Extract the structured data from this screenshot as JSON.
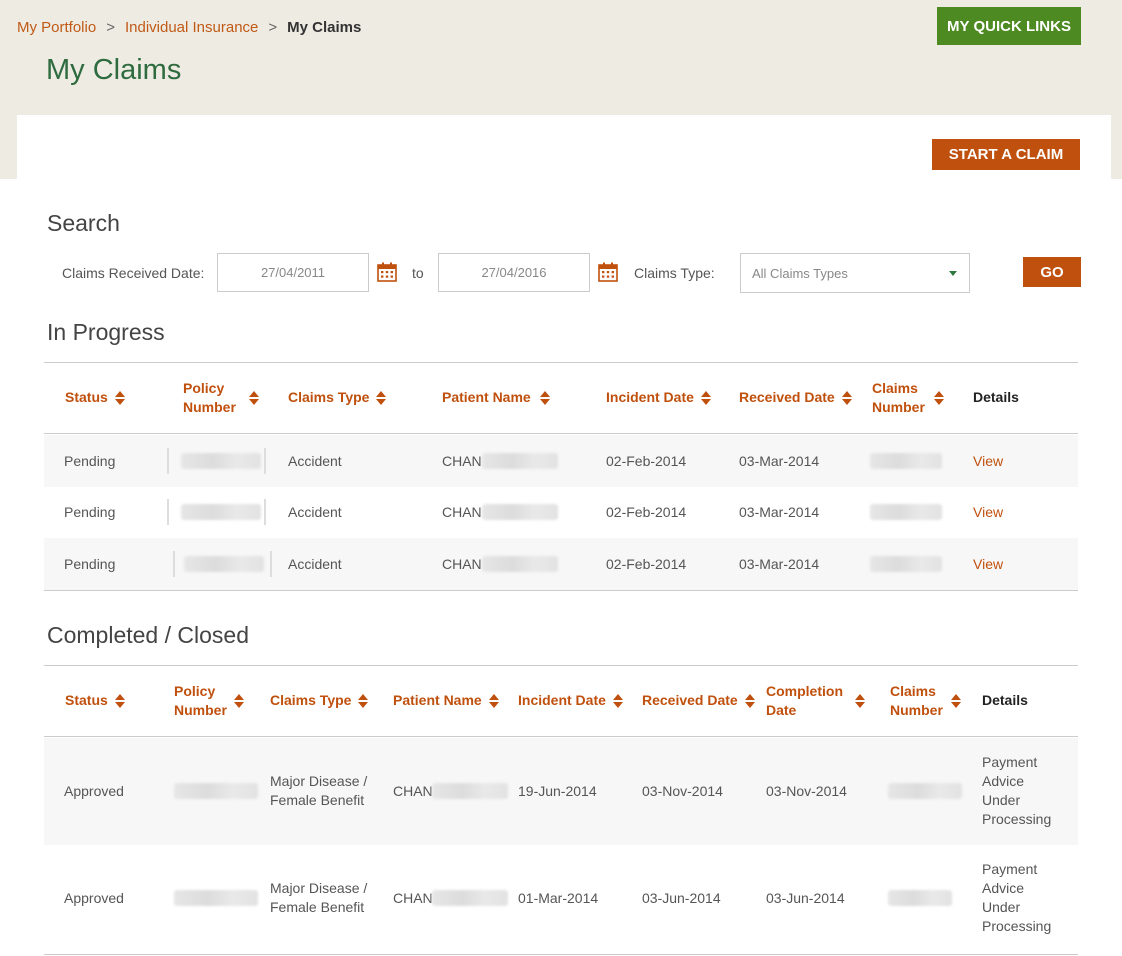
{
  "breadcrumb": {
    "items": [
      "My Portfolio",
      "Individual Insurance"
    ],
    "current": "My Claims",
    "separator": ">"
  },
  "header": {
    "title": "My Claims",
    "quick_links_label": "MY QUICK LINKS",
    "start_claim_label": "START A CLAIM"
  },
  "search": {
    "title": "Search",
    "received_date_label": "Claims Received Date:",
    "from_date": "27/04/2011",
    "to_label": "to",
    "to_date": "27/04/2016",
    "claims_type_label": "Claims Type:",
    "claims_type_value": "All Claims Types",
    "go_label": "GO"
  },
  "in_progress": {
    "title": "In Progress",
    "headers": {
      "status": "Status",
      "policy_1": "Policy",
      "policy_2": "Number",
      "claims_type": "Claims Type",
      "patient_name": "Patient Name",
      "incident_date": "Incident Date",
      "received_date": "Received Date",
      "claims_1": "Claims",
      "claims_2": "Number",
      "details": "Details"
    },
    "rows": [
      {
        "status": "Pending",
        "claims_type": "Accident",
        "patient": "CHAN",
        "incident": "02-Feb-2014",
        "received": "03-Mar-2014",
        "details": "View"
      },
      {
        "status": "Pending",
        "claims_type": "Accident",
        "patient": "CHAN",
        "incident": "02-Feb-2014",
        "received": "03-Mar-2014",
        "details": "View"
      },
      {
        "status": "Pending",
        "claims_type": "Accident",
        "patient": "CHAN",
        "incident": "02-Feb-2014",
        "received": "03-Mar-2014",
        "details": "View"
      }
    ]
  },
  "completed": {
    "title": "Completed / Closed",
    "headers": {
      "status": "Status",
      "policy_1": "Policy",
      "policy_2": "Number",
      "claims_type": "Claims Type",
      "patient_name": "Patient Name",
      "incident_date": "Incident Date",
      "received_date": "Received Date",
      "completion_1": "Completion",
      "completion_2": "Date",
      "claims_1": "Claims",
      "claims_2": "Number",
      "details": "Details"
    },
    "rows": [
      {
        "status": "Approved",
        "type_1": "Major Disease /",
        "type_2": "Female Benefit",
        "patient": "CHAN",
        "incident": "19-Jun-2014",
        "received": "03-Nov-2014",
        "completion": "03-Nov-2014",
        "details_1": "Payment",
        "details_2": "Advice",
        "details_3": "Under",
        "details_4": "Processing"
      },
      {
        "status": "Approved",
        "type_1": "Major Disease /",
        "type_2": "Female Benefit",
        "patient": "CHAN",
        "incident": "01-Mar-2014",
        "received": "03-Jun-2014",
        "completion": "03-Jun-2014",
        "details_1": "Payment",
        "details_2": "Advice",
        "details_3": "Under",
        "details_4": "Processing"
      }
    ]
  },
  "colors": {
    "accent_orange": "#c0500e",
    "brand_green": "#4e8a22",
    "title_green": "#2e6b3e",
    "band_bg": "#eeebe3"
  }
}
